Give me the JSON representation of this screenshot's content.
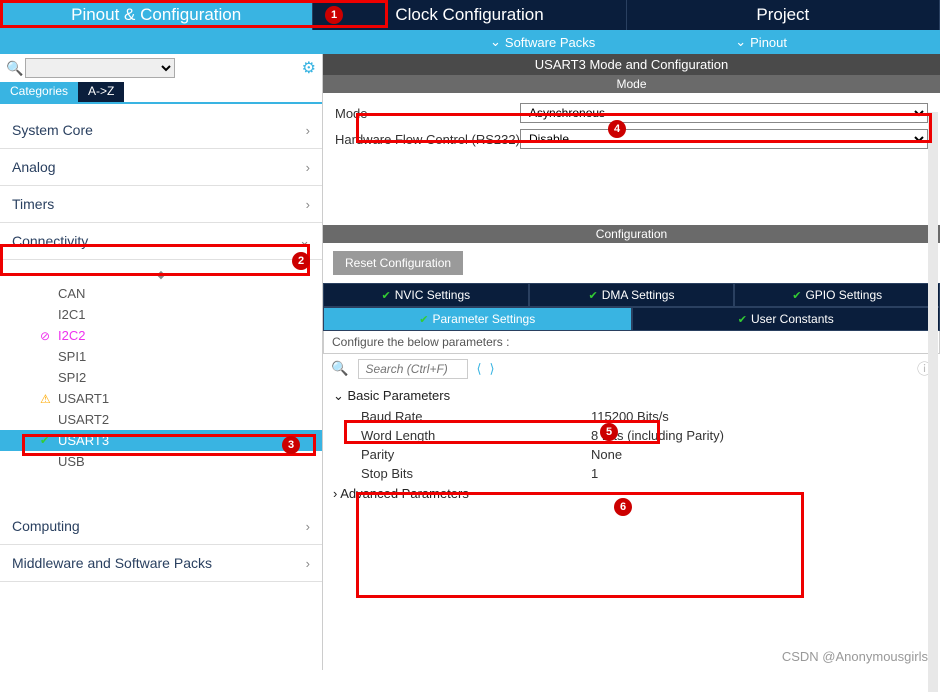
{
  "topTabs": {
    "pinout": "Pinout & Configuration",
    "clock": "Clock Configuration",
    "project": "Project"
  },
  "subBar": {
    "software": "Software Packs",
    "pinout": "Pinout"
  },
  "leftTabs": {
    "categories": "Categories",
    "az": "A->Z"
  },
  "tree": {
    "systemCore": "System Core",
    "analog": "Analog",
    "timers": "Timers",
    "connectivity": "Connectivity",
    "items": {
      "can": "CAN",
      "i2c1": "I2C1",
      "i2c2": "I2C2",
      "spi1": "SPI1",
      "spi2": "SPI2",
      "usart1": "USART1",
      "usart2": "USART2",
      "usart3": "USART3",
      "usb": "USB"
    },
    "computing": "Computing",
    "middleware": "Middleware and Software Packs"
  },
  "rightTitle": "USART3 Mode and Configuration",
  "modeSection": "Mode",
  "modeLabel": "Mode",
  "modeValue": "Asynchronous",
  "flowLabel": "Hardware Flow Control (RS232)",
  "flowValue": "Disable",
  "configSection": "Configuration",
  "resetBtn": "Reset Configuration",
  "cfgTabs": {
    "nvic": "NVIC Settings",
    "dma": "DMA Settings",
    "gpio": "GPIO Settings",
    "param": "Parameter Settings",
    "user": "User Constants"
  },
  "paramLabel": "Configure the below parameters :",
  "paramSearchPlaceholder": "Search (Ctrl+F)",
  "params": {
    "basic": "Basic Parameters",
    "baudLabel": "Baud Rate",
    "baudValue": "115200 Bits/s",
    "wordLabel": "Word Length",
    "wordValue": "8 Bits (including Parity)",
    "parityLabel": "Parity",
    "parityValue": "None",
    "stopLabel": "Stop Bits",
    "stopValue": "1",
    "advanced": "Advanced Parameters"
  },
  "watermark": "CSDN @Anonymousgirls"
}
